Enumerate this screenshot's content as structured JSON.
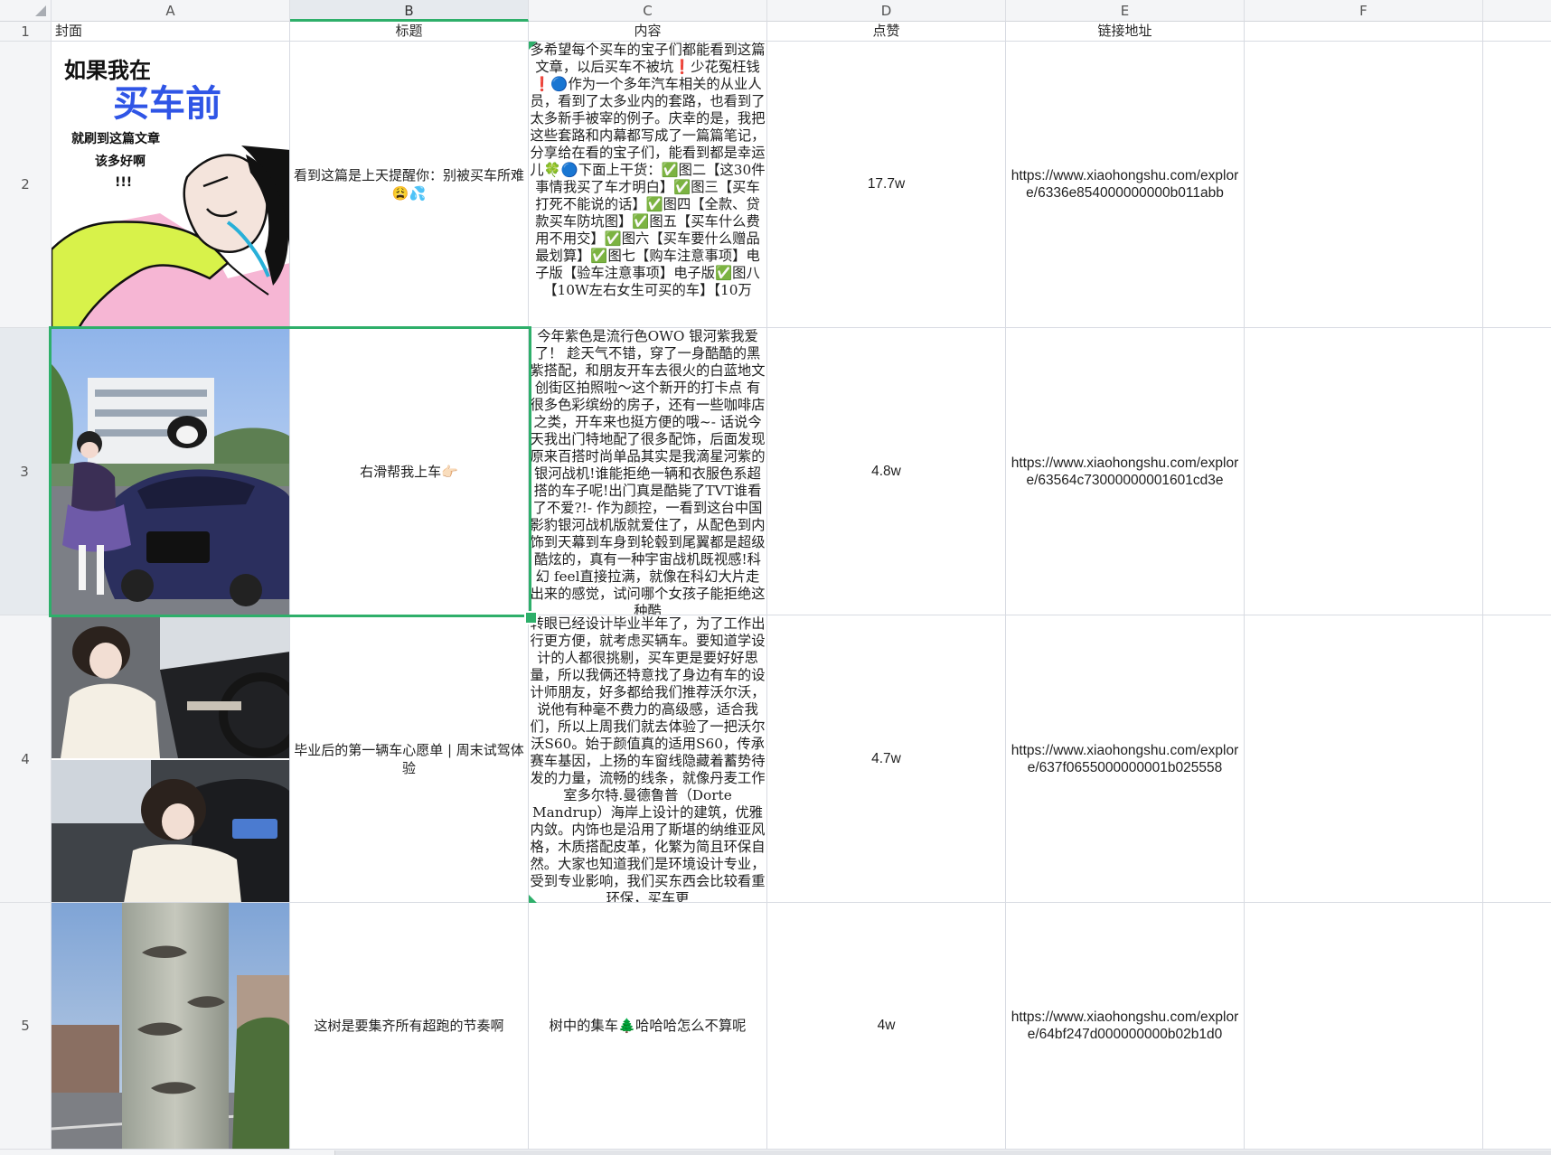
{
  "columns": [
    "A",
    "B",
    "C",
    "D",
    "E",
    "F"
  ],
  "selected_column": "B",
  "selected_row": "3",
  "header_row": {
    "row_label": "1",
    "cover": "封面",
    "title": "标题",
    "content": "内容",
    "likes": "点赞",
    "link": "链接地址"
  },
  "rows": [
    {
      "row_label": "2",
      "cover_image": "cover-illustration-crying-girl",
      "cover_text": {
        "line1": "如果我在",
        "line2": "买车前",
        "line3": "就刷到这篇文章",
        "line4": "该多好啊",
        "line5": "!!!"
      },
      "title": "看到这篇是上天提醒你：别被买车所难😩💦",
      "content": "多希望每个买车的宝子们都能看到这篇文章，以后买车不被坑❗少花冤枉钱❗🔵作为一个多年汽车相关的从业人员，看到了太多业内的套路，也看到了太多新手被宰的例子。庆幸的是，我把这些套路和内幕都写成了一篇篇笔记，分享给在看的宝子们，能看到都是幸运儿🍀🔵下面上干货：✅图二【这30件事情我买了车才明白】✅图三【买车打死不能说的话】✅图四【全款、贷款买车防坑图】✅图五【买车什么费用不用交】✅图六【买车要什么赠品最划算】✅图七【购车注意事项】电子版【验车注意事项】电子版✅图八【10W左右女生可买的车】【10万",
      "likes": "17.7w",
      "link": "https://www.xiaohongshu.com/explore/6336e854000000000b011abb"
    },
    {
      "row_label": "3",
      "cover_image": "cover-photo-girl-with-blue-car",
      "title": "右滑帮我上车👉🏻",
      "content": "今年紫色是流行色OWO 银河紫我爱了！ 趁天气不错，穿了一身酷酷的黑紫搭配，和朋友开车去很火的白蓝地文创街区拍照啦～这个新开的打卡点 有很多色彩缤纷的房子，还有一些咖啡店之类，开车来也挺方便的哦~- 话说今天我出门特地配了很多配饰，后面发现原来百搭时尚单品其实是我滴星河紫的银河战机!谁能拒绝一辆和衣服色系超搭的车子呢!出门真是酷毙了TVT谁看了不爱?!- 作为颜控，一看到这台中国影豹银河战机版就爱住了，从配色到内饰到天幕到车身到轮毂到尾翼都是超级酷炫的，真有一种宇宙战机既视感!科幻 feel直接拉满，就像在科幻大片走出来的感觉，试问哪个女孩子能拒绝这种酷",
      "likes": "4.8w",
      "link": "https://www.xiaohongshu.com/explore/63564c73000000001601cd3e"
    },
    {
      "row_label": "4",
      "cover_image": "cover-photos-girl-in-car",
      "title": "毕业后的第一辆车心愿单 | 周末试驾体验",
      "content": "转眼已经设计毕业半年了，为了工作出行更方便，就考虑买辆车。要知道学设计的人都很挑剔，买车更是要好好思量，所以我俩还特意找了身边有车的设计师朋友，好多都给我们推荐沃尔沃，说他有种毫不费力的高级感，适合我们，所以上周我们就去体验了一把沃尔沃S60。始于颜值真的适用S60，传承赛车基因，上扬的车窗线隐藏着蓄势待发的力量，流畅的线条，就像丹麦工作室多尔特.曼德鲁普（Dorte Mandrup）海岸上设计的建筑，优雅内敛。内饰也是沿用了斯堪的纳维亚风格，木质搭配皮革，化繁为简且环保自然。大家也知道我们是环境设计专业，受到专业影响，我们买东西会比较看重环保，买车更",
      "likes": "4.7w",
      "link": "https://www.xiaohongshu.com/explore/637f0655000000001b025558"
    },
    {
      "row_label": "5",
      "cover_image": "cover-photo-tree-trunk",
      "title": "这树是要集齐所有超跑的节奏啊",
      "content": "树中的集车🌲哈哈哈怎么不算呢",
      "likes": "4w",
      "link": "https://www.xiaohongshu.com/explore/64bf247d000000000b02b1d0"
    }
  ],
  "colors": {
    "accent_green": "#2eaf6a",
    "header_bg": "#f4f5f7",
    "grid_line": "#d8dbe2",
    "cover1_title_blue": "#2f55e6",
    "cover1_pink": "#f6b6d4",
    "cover1_lime": "#d8f24a"
  }
}
